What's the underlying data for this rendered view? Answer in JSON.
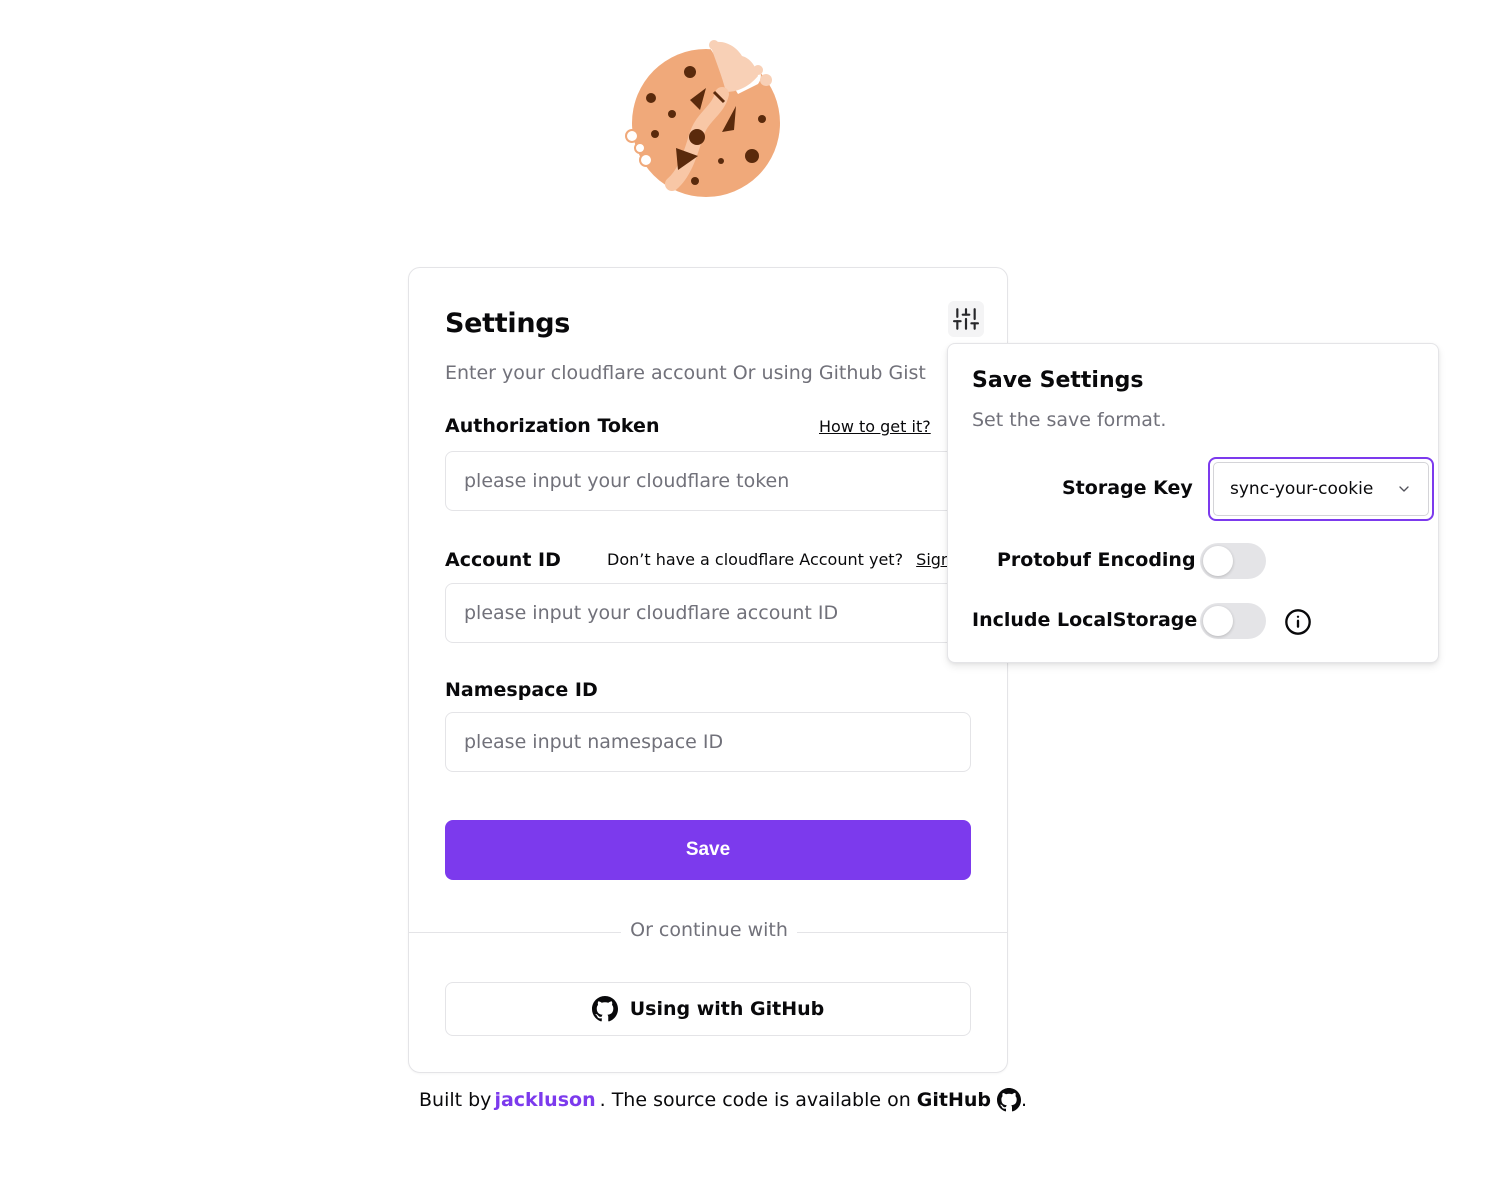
{
  "card": {
    "title": "Settings",
    "description": "Enter your cloudflare account Or using Github Gist",
    "fields": {
      "token_label": "Authorization Token",
      "token_help_link": "How to get it?",
      "token_placeholder": "please input your cloudflare token",
      "account_label": "Account ID",
      "account_help_text": "Don’t have a cloudflare Account yet?",
      "account_help_link": "Sign",
      "account_placeholder": "please input your cloudflare account ID",
      "namespace_label": "Namespace ID",
      "namespace_placeholder": "please input namespace ID"
    },
    "save_label": "Save",
    "divider_text": "Or continue with",
    "github_button_label": "Using with GitHub"
  },
  "footer": {
    "prefix": "Built by",
    "author": "jackluson",
    "middle": ". The source code is available on",
    "github": "GitHub",
    "suffix": "."
  },
  "popover": {
    "title": "Save Settings",
    "description": "Set the save format.",
    "storage_key_label": "Storage Key",
    "storage_key_value": "sync-your-cookie",
    "protobuf_label": "Protobuf Encoding",
    "protobuf_enabled": false,
    "localstorage_label": "Include LocalStorage",
    "localstorage_enabled": false
  },
  "colors": {
    "accent": "#7c3aed",
    "muted_text": "#71717a",
    "border": "#e4e4e7",
    "cookie": "#f0a97a"
  },
  "icons": [
    "cookie-logo",
    "sliders-icon",
    "github-icon",
    "chevron-down-icon",
    "info-icon"
  ]
}
